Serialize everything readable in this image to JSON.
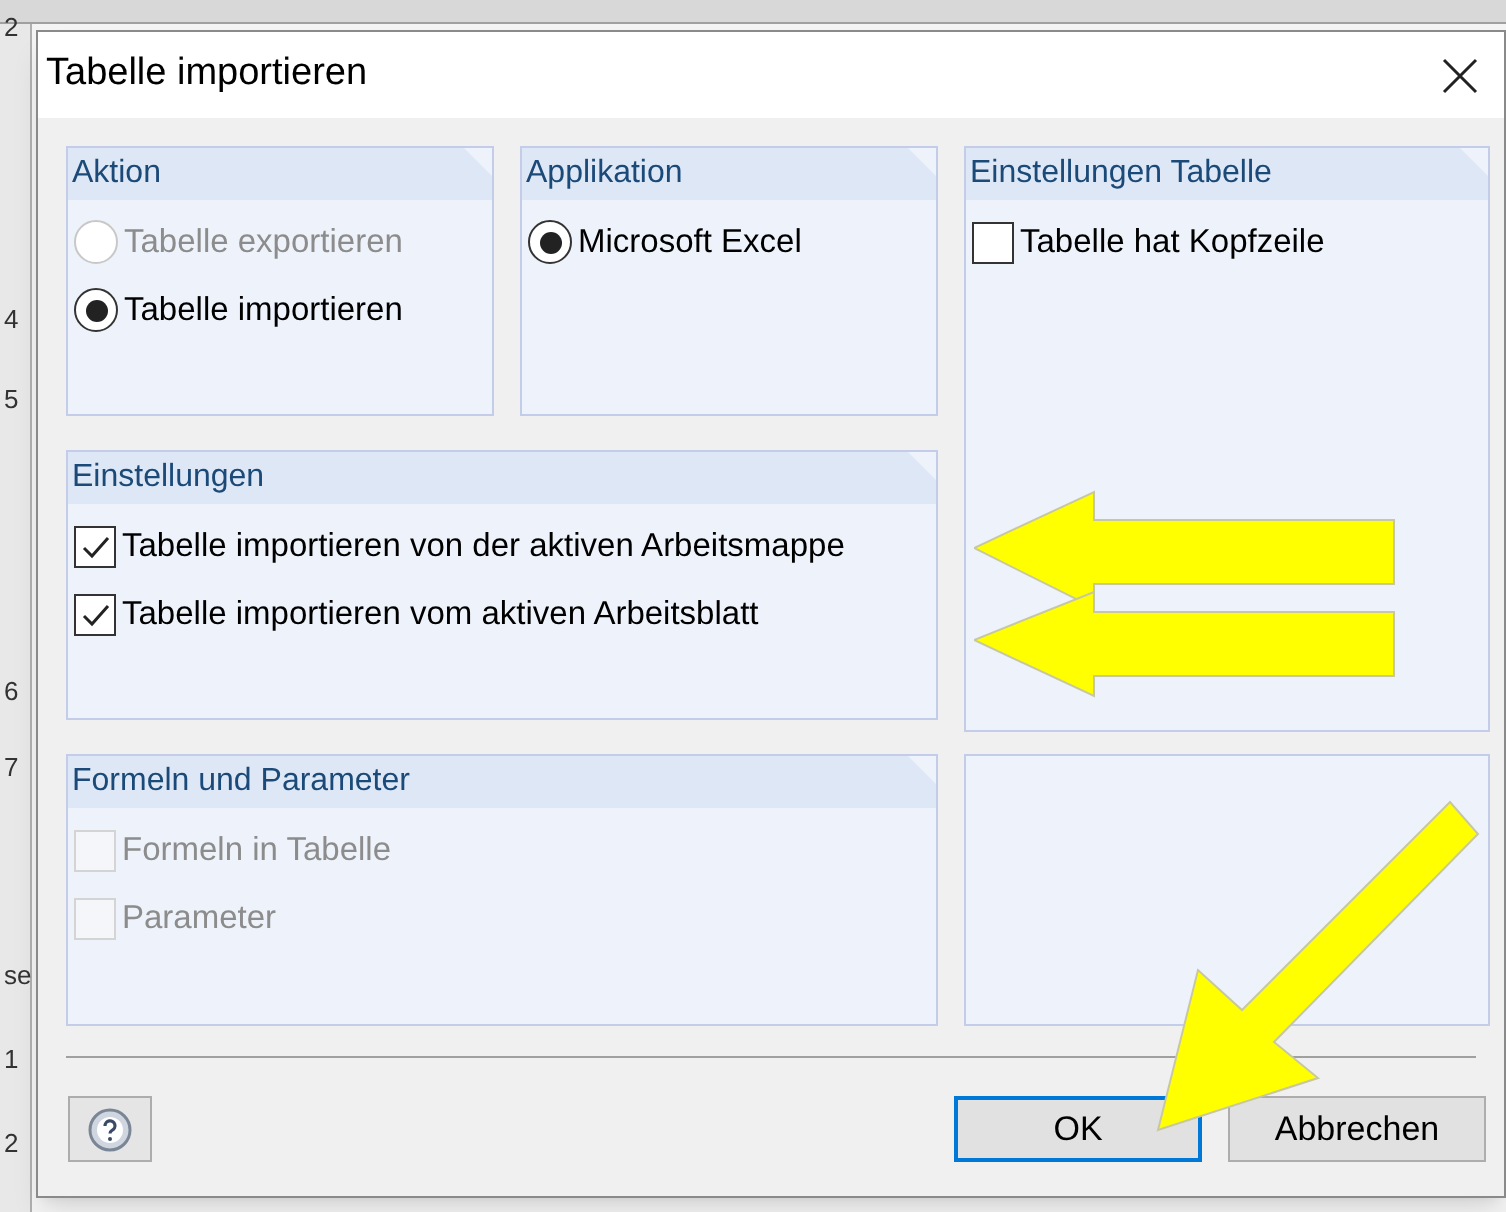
{
  "background": {
    "row_labels": [
      "2",
      "4",
      "5",
      "6",
      "7",
      "se",
      "1",
      "2"
    ]
  },
  "window": {
    "title": "Tabelle importieren"
  },
  "groups": [
    {
      "title": "Aktion",
      "items": [
        {
          "kind": "radio",
          "label": "Tabelle exportieren",
          "selected": false,
          "disabled": true
        },
        {
          "kind": "radio",
          "label": "Tabelle importieren",
          "selected": true,
          "disabled": false
        }
      ]
    },
    {
      "title": "Applikation",
      "items": [
        {
          "kind": "radio",
          "label": "Microsoft Excel",
          "selected": true,
          "disabled": false
        }
      ]
    },
    {
      "title": "Einstellungen Tabelle",
      "items": [
        {
          "kind": "checkbox",
          "label": "Tabelle hat Kopfzeile",
          "checked": false,
          "disabled": false
        }
      ]
    },
    {
      "title": "Einstellungen",
      "items": [
        {
          "kind": "checkbox",
          "label": "Tabelle importieren von der aktiven Arbeitsmappe",
          "checked": true,
          "disabled": false
        },
        {
          "kind": "checkbox",
          "label": "Tabelle importieren vom aktiven Arbeitsblatt",
          "checked": true,
          "disabled": false
        }
      ]
    },
    {
      "title": "Formeln und Parameter",
      "items": [
        {
          "kind": "checkbox",
          "label": "Formeln in Tabelle",
          "checked": false,
          "disabled": true
        },
        {
          "kind": "checkbox",
          "label": "Parameter",
          "checked": false,
          "disabled": true
        }
      ]
    }
  ],
  "buttons": [
    {
      "label": "OK",
      "default": true
    },
    {
      "label": "Abbrechen",
      "default": false
    }
  ]
}
